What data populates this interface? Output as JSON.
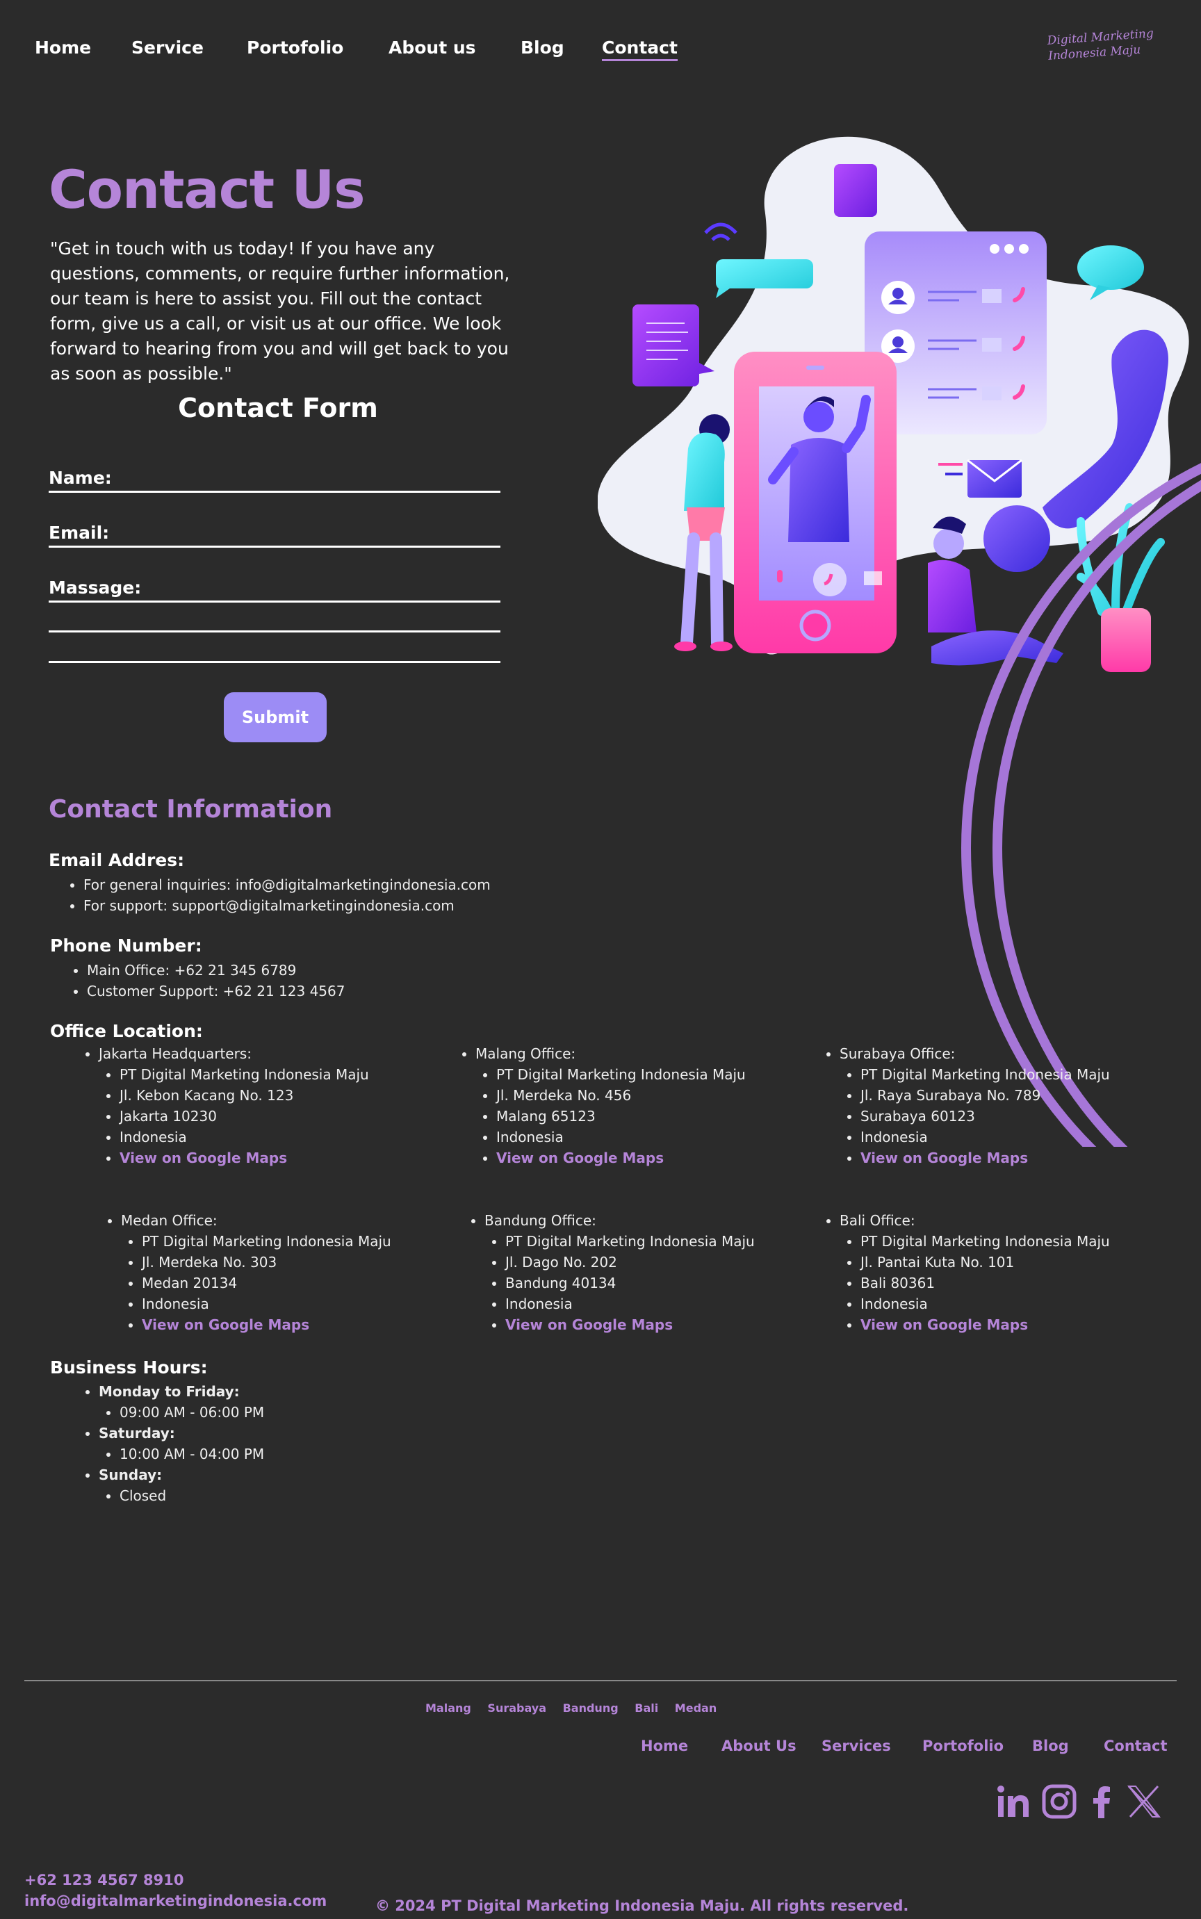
{
  "nav": {
    "items": [
      "Home",
      "Service",
      "Portofolio",
      "About us",
      "Blog",
      "Contact"
    ],
    "active": "Contact"
  },
  "logo": {
    "line1": "Digital Marketing",
    "line2": "Indonesia Maju"
  },
  "hero": {
    "title": "Contact Us",
    "intro": "\"Get in touch with us today! If you have any questions, comments, or require further information, our team is here to assist you. Fill out the contact form, give us a call, or visit us at our office. We look forward to hearing from you and will get back to you as soon as possible.\""
  },
  "form": {
    "title": "Contact Form",
    "name_label": "Name:",
    "email_label": "Email:",
    "message_label": "Massage:",
    "submit_label": "Submit"
  },
  "info": {
    "title": "Contact Information",
    "email": {
      "heading": "Email Addres:",
      "items": [
        "For general inquiries: info@digitalmarketingindonesia.com",
        "For support: support@digitalmarketingindonesia.com"
      ]
    },
    "phone": {
      "heading": "Phone Number:",
      "items": [
        "Main Office: +62 21 345 6789",
        "Customer Support: +62 21 123 4567"
      ]
    },
    "offices": {
      "heading": "Office Location:",
      "map_label": "View on Google Maps",
      "list": [
        {
          "name": "Jakarta Headquarters:",
          "company": "PT Digital Marketing Indonesia Maju",
          "street": "Jl. Kebon Kacang No. 123",
          "city": "Jakarta 10230",
          "country": "Indonesia"
        },
        {
          "name": "Malang Office:",
          "company": "PT Digital Marketing Indonesia Maju",
          "street": "Jl. Merdeka No. 456",
          "city": "Malang 65123",
          "country": "Indonesia"
        },
        {
          "name": "Surabaya Office:",
          "company": "PT Digital Marketing Indonesia Maju",
          "street": "Jl. Raya Surabaya No. 789",
          "city": "Surabaya 60123",
          "country": "Indonesia"
        },
        {
          "name": "Medan Office:",
          "company": "PT Digital Marketing Indonesia Maju",
          "street": "Jl. Merdeka No. 303",
          "city": "Medan 20134",
          "country": "Indonesia"
        },
        {
          "name": "Bandung Office:",
          "company": "PT Digital Marketing Indonesia Maju",
          "street": "Jl. Dago No. 202",
          "city": "Bandung 40134",
          "country": "Indonesia"
        },
        {
          "name": "Bali Office:",
          "company": "PT Digital Marketing Indonesia Maju",
          "street": "Jl. Pantai Kuta No. 101",
          "city": "Bali 80361",
          "country": "Indonesia"
        }
      ]
    },
    "hours": {
      "heading": "Business Hours:",
      "weekday_label": "Monday to Friday:",
      "weekday_time": "09:00 AM - 06:00 PM",
      "saturday_label": "Saturday:",
      "saturday_time": "10:00 AM - 04:00 PM",
      "sunday_label": "Sunday:",
      "sunday_time": "Closed"
    }
  },
  "footer": {
    "cities": [
      "Malang",
      "Surabaya",
      "Bandung",
      "Bali",
      "Medan"
    ],
    "nav": [
      "Home",
      "About Us",
      "Services",
      "Portofolio",
      "Blog",
      "Contact"
    ],
    "social": [
      "linkedin-icon",
      "instagram-icon",
      "facebook-icon",
      "x-icon"
    ],
    "phone": "+62 123 4567 8910",
    "email": "info@digitalmarketingindonesia.com",
    "copyright": "© 2024 PT Digital Marketing Indonesia Maju. All rights reserved."
  },
  "colors": {
    "background": "#2b2b2b",
    "accent": "#b585d8",
    "button": "#9c8cf5"
  }
}
